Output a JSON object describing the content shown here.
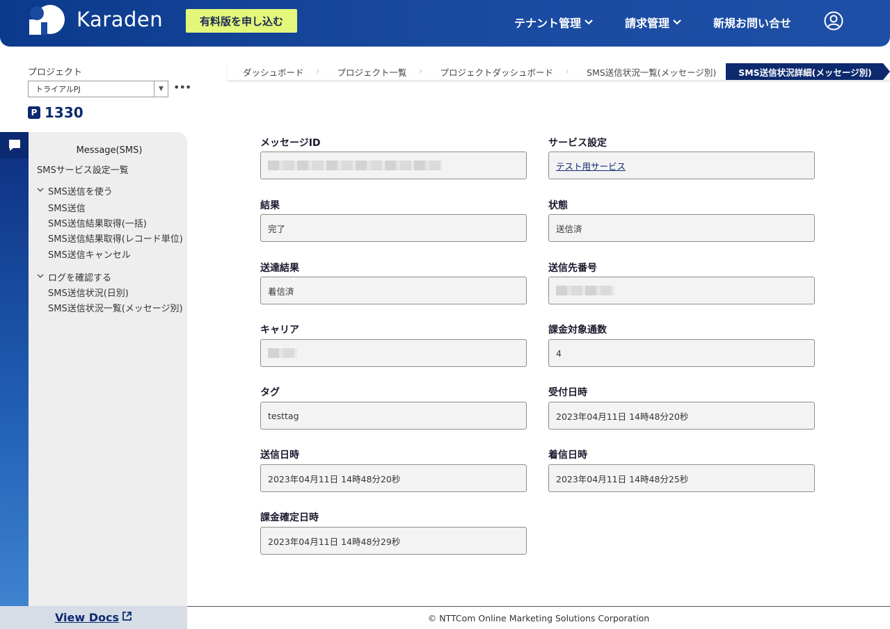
{
  "header": {
    "logo_text": "Karaden",
    "trial_button": "有料版を申し込む",
    "nav": [
      {
        "label": "テナント管理",
        "has_dropdown": true
      },
      {
        "label": "請求管理",
        "has_dropdown": true
      },
      {
        "label": "新規お問い合せ",
        "has_dropdown": false
      }
    ],
    "user_icon": "user-circle-icon"
  },
  "sidebar": {
    "project_label": "プロジェクト",
    "project_selected": "トライアルPJ",
    "points_badge": "P",
    "points": "1330",
    "section_icon": "chat-bubble-icon",
    "section_title": "Message(SMS)",
    "top_link": "SMSサービス設定一覧",
    "groups": [
      {
        "label": "SMS送信を使う",
        "items": [
          "SMS送信",
          "SMS送信結果取得(一括)",
          "SMS送信結果取得(レコード単位)",
          "SMS送信キャンセル"
        ]
      },
      {
        "label": "ログを確認する",
        "items": [
          "SMS送信状況(日別)",
          "SMS送信状況一覧(メッセージ別)"
        ]
      }
    ],
    "docs_link": "View Docs"
  },
  "breadcrumb": [
    "ダッシュボード",
    "プロジェクト一覧",
    "プロジェクトダッシュボード",
    "SMS送信状況一覧(メッセージ別)",
    "SMS送信状況詳細(メッセージ別)"
  ],
  "fields": {
    "message_id": {
      "label": "メッセージID",
      "value": ""
    },
    "service": {
      "label": "サービス設定",
      "value": "テスト用サービス"
    },
    "result": {
      "label": "結果",
      "value": "完了"
    },
    "status": {
      "label": "状態",
      "value": "送信済"
    },
    "delivery": {
      "label": "送達結果",
      "value": "着信済"
    },
    "destination": {
      "label": "送信先番号",
      "value": ""
    },
    "carrier": {
      "label": "キャリア",
      "value": ""
    },
    "billing_count": {
      "label": "課金対象通数",
      "value": "4"
    },
    "tag": {
      "label": "タグ",
      "value": "testtag"
    },
    "received_at": {
      "label": "受付日時",
      "value": "2023年04月11日 14時48分20秒"
    },
    "sent_at": {
      "label": "送信日時",
      "value": "2023年04月11日 14時48分20秒"
    },
    "arrived_at": {
      "label": "着信日時",
      "value": "2023年04月11日 14時48分25秒"
    },
    "billing_confirmed_at": {
      "label": "課金確定日時",
      "value": "2023年04月11日 14時48分29秒"
    }
  },
  "footer": "© NTTCom Online Marketing Solutions Corporation",
  "colors": {
    "header_primary": "#0b3a8c",
    "accent_yellow": "#e3f77a",
    "brand_navy": "#0d2a6e"
  }
}
